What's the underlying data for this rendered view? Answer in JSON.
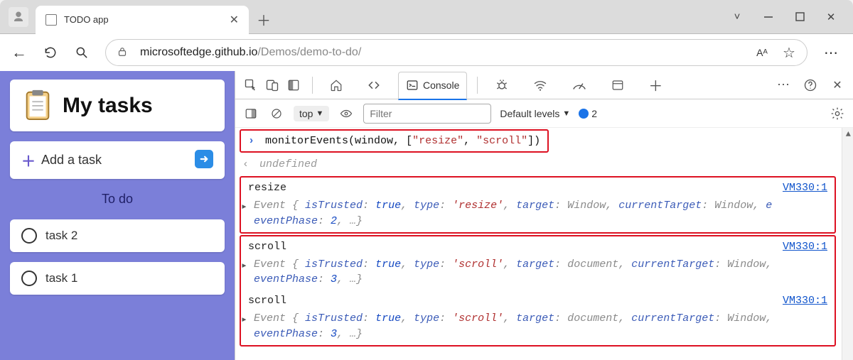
{
  "tab": {
    "title": "TODO app",
    "close_glyph": "✕",
    "newtab_glyph": "＋"
  },
  "window": {
    "caret_down": "˅",
    "minimize_aria": "Minimize",
    "maximize_aria": "Maximize",
    "close_glyph": "✕"
  },
  "nav": {
    "back_glyph": "←",
    "url_host": "microsoftedge.github.io",
    "url_path": "/Demos/demo-to-do/",
    "reading_mode": "Aᴬ",
    "favorite": "☆",
    "more": "⋯"
  },
  "page": {
    "heading": "My tasks",
    "add_label": "Add a task",
    "todo_section": "To do",
    "tasks": [
      "task 2",
      "task 1"
    ]
  },
  "devtools": {
    "tabs": {
      "console": "Console",
      "more_glyph": "⋯",
      "close_glyph": "✕"
    },
    "filter": {
      "context": "top",
      "filter_placeholder": "Filter",
      "levels_label": "Default levels",
      "issue_count": "2"
    },
    "console": {
      "cmd_prefix": "monitorEvents(window, [",
      "cmd_arg1": "\"resize\"",
      "cmd_sep": ", ",
      "cmd_arg2": "\"scroll\"",
      "cmd_suffix": "])",
      "undefined_label": "undefined",
      "events": [
        {
          "name": "resize",
          "source": "VM330:1",
          "body_pre": "Event {",
          "pairs": [
            {
              "k": "isTrusted",
              "v": "true",
              "cls": "v-blue"
            },
            {
              "k": "type",
              "v": "'resize'",
              "cls": "v-red"
            },
            {
              "k": "target",
              "v": "Window",
              "cls": "v-gray"
            },
            {
              "k": "currentTarget",
              "v": "Window",
              "cls": "v-gray"
            }
          ],
          "tail_wrap_key": "eventPhase",
          "tail_wrap_val": "2",
          "tail_more": ", …}",
          "trailing_char": "e"
        },
        {
          "name": "scroll",
          "source": "VM330:1",
          "body_pre": "Event {",
          "pairs": [
            {
              "k": "isTrusted",
              "v": "true",
              "cls": "v-blue"
            },
            {
              "k": "type",
              "v": "'scroll'",
              "cls": "v-red"
            },
            {
              "k": "target",
              "v": "document",
              "cls": "v-gray"
            },
            {
              "k": "currentTarget",
              "v": "Window",
              "cls": "v-gray"
            }
          ],
          "tail_wrap_key": "eventPhase",
          "tail_wrap_val": "3",
          "tail_more": ", …}",
          "trailing_char": ""
        },
        {
          "name": "scroll",
          "source": "VM330:1",
          "body_pre": "Event {",
          "pairs": [
            {
              "k": "isTrusted",
              "v": "true",
              "cls": "v-blue"
            },
            {
              "k": "type",
              "v": "'scroll'",
              "cls": "v-red"
            },
            {
              "k": "target",
              "v": "document",
              "cls": "v-gray"
            },
            {
              "k": "currentTarget",
              "v": "Window",
              "cls": "v-gray"
            }
          ],
          "tail_wrap_key": "eventPhase",
          "tail_wrap_val": "3",
          "tail_more": ", …}",
          "trailing_char": ""
        }
      ]
    }
  }
}
